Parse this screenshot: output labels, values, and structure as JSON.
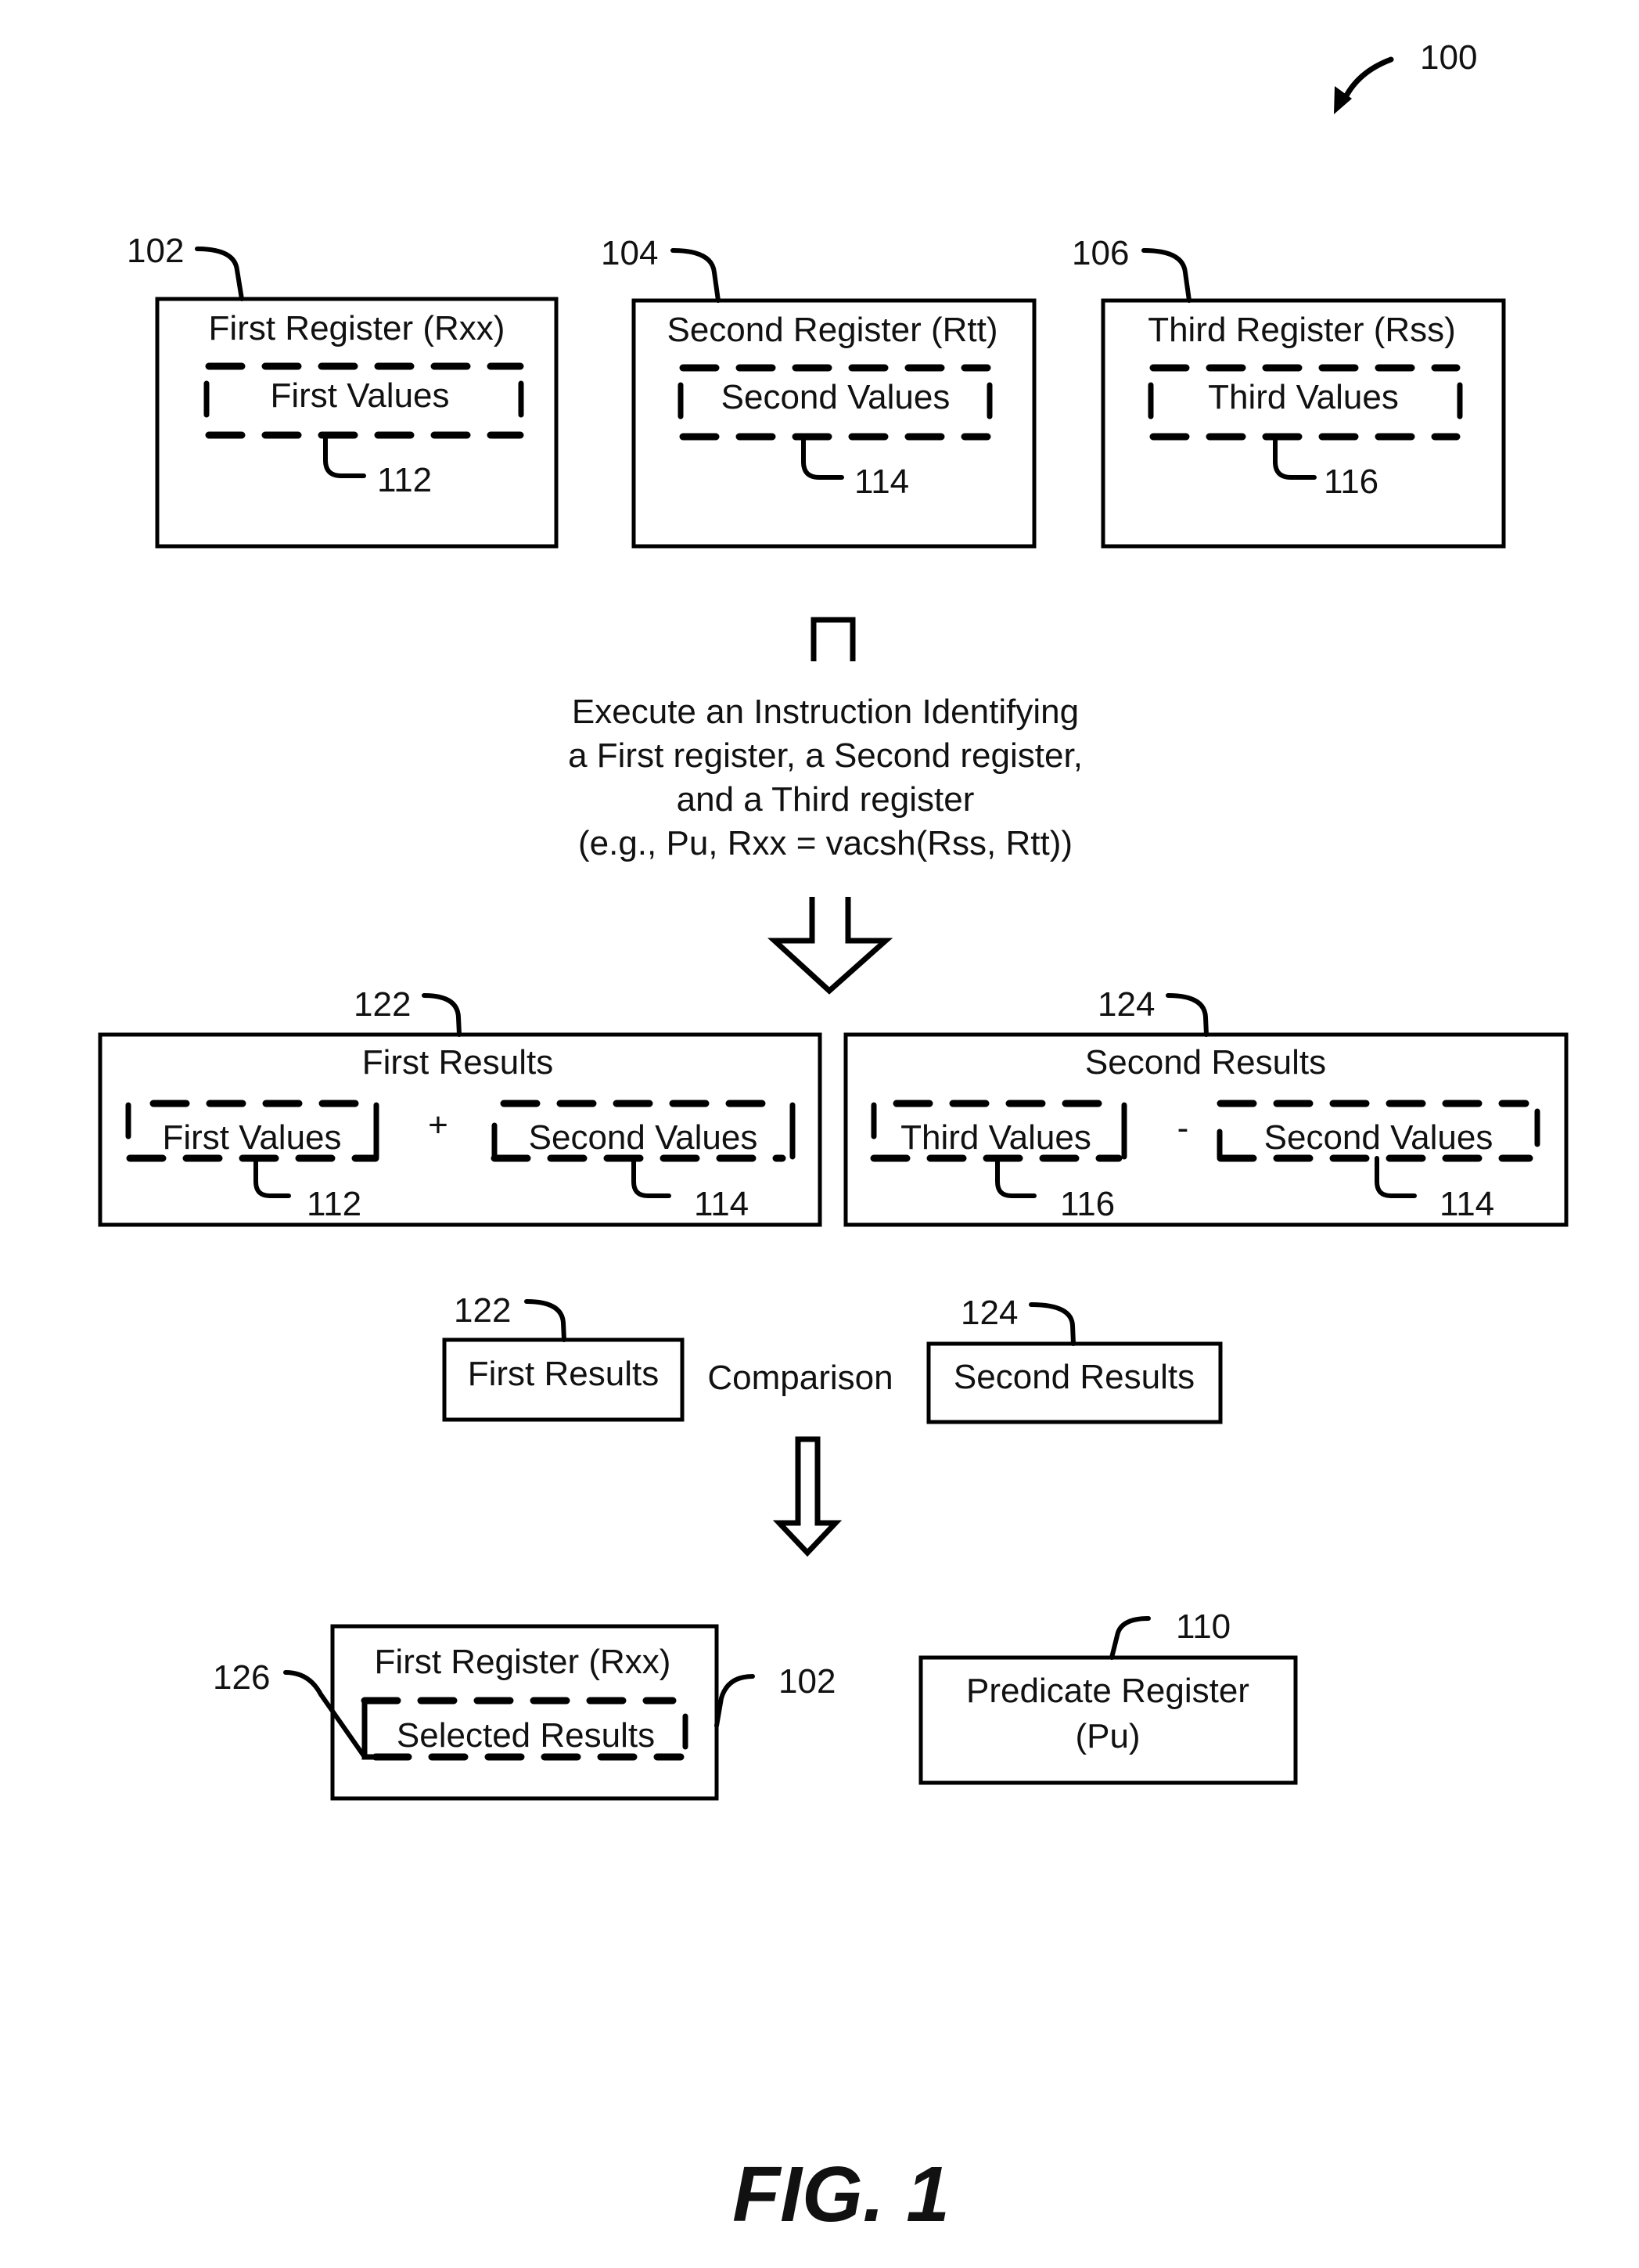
{
  "figure": {
    "ref": "100",
    "caption": "FIG. 1"
  },
  "registers": [
    {
      "ref": "102",
      "title": "First Register (Rxx)",
      "values_label": "First Values",
      "values_ref": "112"
    },
    {
      "ref": "104",
      "title": "Second Register (Rtt)",
      "values_label": "Second Values",
      "values_ref": "114"
    },
    {
      "ref": "106",
      "title": "Third Register (Rss)",
      "values_label": "Third Values",
      "values_ref": "116"
    }
  ],
  "instruction": {
    "lines": [
      "Execute an Instruction Identifying",
      "a First register, a Second register,",
      "and a Third register",
      "(e.g., Pu, Rxx = vacsh(Rss, Rtt))"
    ]
  },
  "results": [
    {
      "ref": "122",
      "title": "First Results",
      "operator": "+",
      "left": {
        "label": "First Values",
        "ref": "112"
      },
      "right": {
        "label": "Second Values",
        "ref": "114"
      }
    },
    {
      "ref": "124",
      "title": "Second Results",
      "operator": "-",
      "left": {
        "label": "Third Values",
        "ref": "116"
      },
      "right": {
        "label": "Second Values",
        "ref": "114"
      }
    }
  ],
  "comparison": {
    "left": {
      "ref": "122",
      "label": "First Results"
    },
    "operator_label": "Comparison",
    "right": {
      "ref": "124",
      "label": "Second Results"
    }
  },
  "outputs": {
    "first_register": {
      "ref": "102",
      "title": "First Register (Rxx)",
      "inner_label": "Selected Results",
      "inner_ref": "126"
    },
    "predicate_register": {
      "ref": "110",
      "title_line1": "Predicate Register",
      "title_line2": "(Pu)"
    }
  }
}
